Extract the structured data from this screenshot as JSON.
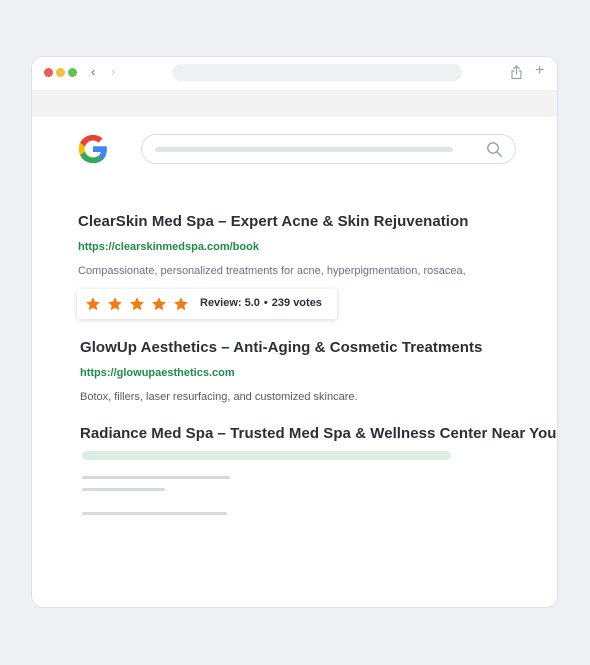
{
  "browser": {
    "back_glyph": "‹",
    "forward_glyph": "›",
    "new_tab_glyph": "+",
    "icons": [
      "share-icon",
      "plus-icon",
      "back-icon",
      "forward-icon"
    ]
  },
  "search": {
    "logo": "google-logo",
    "icon": "search-icon"
  },
  "results": [
    {
      "title": "ClearSkin Med Spa – Expert Acne & Skin Rejuvenation",
      "url": "https://clearskinmedspa.com/book",
      "description": "Compassionate, personalized treatments for acne, hyperpigmentation, rosacea,"
    },
    {
      "title": "GlowUp Aesthetics – Anti-Aging & Cosmetic Treatments",
      "url": "https://glowupaesthetics.com",
      "description": "Botox, fillers, laser resurfacing, and customized skincare."
    },
    {
      "title": "Radiance Med Spa – Trusted Med Spa & Wellness Center Near You"
    }
  ],
  "rating": {
    "stars": 5,
    "max_stars": 5,
    "review_label": "Review: 5.0",
    "separator": "•",
    "votes_label": "239 votes",
    "star_color": "#f07d12"
  },
  "colors": {
    "url_green": "#1e8c4a",
    "title_text": "#2b2f38",
    "placeholder_green": "#dbeee3"
  }
}
